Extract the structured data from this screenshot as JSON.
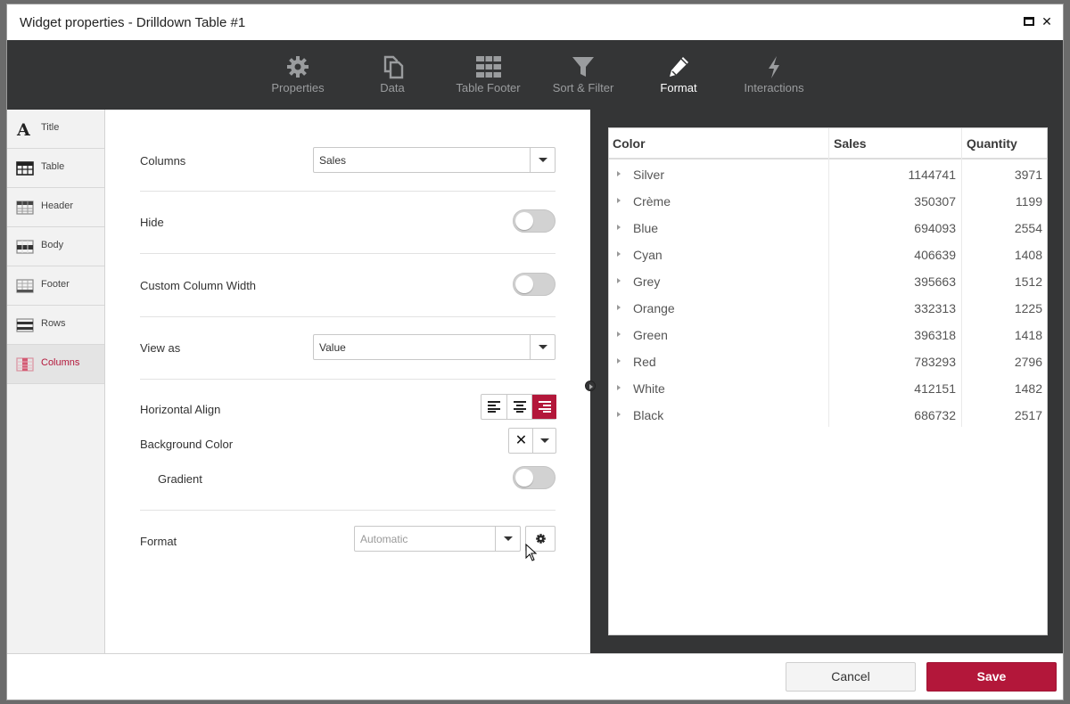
{
  "window": {
    "title": "Widget properties - Drilldown Table #1"
  },
  "toolbar": {
    "tabs": [
      {
        "label": "Properties",
        "icon": "gear-icon"
      },
      {
        "label": "Data",
        "icon": "copy-icon"
      },
      {
        "label": "Table Footer",
        "icon": "table-rows-icon"
      },
      {
        "label": "Sort & Filter",
        "icon": "funnel-icon"
      },
      {
        "label": "Format",
        "icon": "pencil-icon",
        "active": true
      },
      {
        "label": "Interactions",
        "icon": "bolt-icon"
      }
    ]
  },
  "sidebar": {
    "items": [
      {
        "label": "Title",
        "icon": "title-letter-icon"
      },
      {
        "label": "Table",
        "icon": "table-icon"
      },
      {
        "label": "Header",
        "icon": "header-icon"
      },
      {
        "label": "Body",
        "icon": "body-icon"
      },
      {
        "label": "Footer",
        "icon": "footer-icon"
      },
      {
        "label": "Rows",
        "icon": "rows-icon"
      },
      {
        "label": "Columns",
        "icon": "columns-icon",
        "active": true
      }
    ]
  },
  "form": {
    "columns": {
      "label": "Columns",
      "value": "Sales"
    },
    "hide": {
      "label": "Hide",
      "on": false
    },
    "custom_width": {
      "label": "Custom Column Width",
      "on": false
    },
    "view_as": {
      "label": "View as",
      "value": "Value"
    },
    "horizontal_align": {
      "label": "Horizontal Align",
      "selected": "right"
    },
    "background_color": {
      "label": "Background Color"
    },
    "gradient": {
      "label": "Gradient",
      "on": false
    },
    "format": {
      "label": "Format",
      "placeholder": "Automatic"
    }
  },
  "preview": {
    "headers": [
      "Color",
      "Sales",
      "Quantity"
    ],
    "rows": [
      {
        "color": "Silver",
        "sales": "1144741",
        "qty": "3971"
      },
      {
        "color": "Crème",
        "sales": "350307",
        "qty": "1199"
      },
      {
        "color": "Blue",
        "sales": "694093",
        "qty": "2554"
      },
      {
        "color": "Cyan",
        "sales": "406639",
        "qty": "1408"
      },
      {
        "color": "Grey",
        "sales": "395663",
        "qty": "1512"
      },
      {
        "color": "Orange",
        "sales": "332313",
        "qty": "1225"
      },
      {
        "color": "Green",
        "sales": "396318",
        "qty": "1418"
      },
      {
        "color": "Red",
        "sales": "783293",
        "qty": "2796"
      },
      {
        "color": "White",
        "sales": "412151",
        "qty": "1482"
      },
      {
        "color": "Black",
        "sales": "686732",
        "qty": "2517"
      }
    ]
  },
  "footer": {
    "cancel_label": "Cancel",
    "save_label": "Save"
  },
  "colors": {
    "accent": "#b3173a",
    "toolbar_bg": "#343536"
  }
}
